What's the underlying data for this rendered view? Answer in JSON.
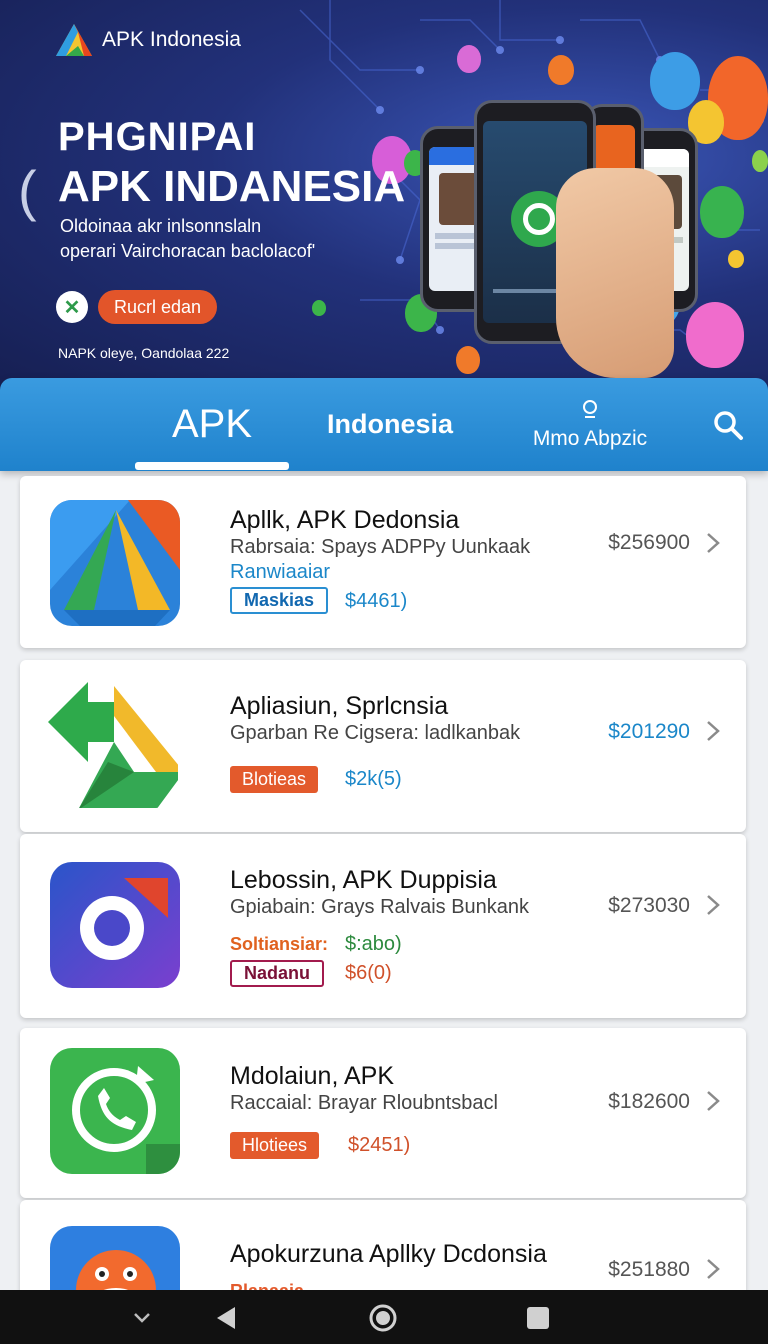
{
  "brand": {
    "name": "APK Indonesia"
  },
  "hero": {
    "title_line1": "PHGNIPAI",
    "title_line2": "APK INDANESIA",
    "subtitle_line1": "Oldoinaa akr inlsonnslaln",
    "subtitle_line2": "operari Vairchoracan baclolacof'",
    "cta_label": "Rucrl edan",
    "footer": "NAPK oleye, Oandolaa 222"
  },
  "tabs": {
    "apk": "APK",
    "indonesia": "Indonesia",
    "more": "Mmo Abpzic"
  },
  "apps": [
    {
      "title": "Apllk, APK Dedonsia",
      "desc": "Rabrsaia: Spays ADPPy Uunkaak",
      "sub": "Ranwiaaiar",
      "tag": "Maskias",
      "tag_price": "$4461)",
      "price": "$256900"
    },
    {
      "title": "Apliasiun, Sprlcnsia",
      "desc": "Gparban Re Cigsera: ladlkanbak",
      "tag": "Blotieas",
      "tag_price": "$2k(5)",
      "price": "$201290"
    },
    {
      "title": "Lebossin, APK Duppisia",
      "desc": "Gpiabain: Grays Ralvais Bunkank",
      "tag1": "Soltiansiar:",
      "tag1_price": "$:abo)",
      "tag2": "Nadanu",
      "tag2_price": "$6(0)",
      "price": "$273030"
    },
    {
      "title": "Mdolaiun, APK",
      "desc": "Raccaial: Brayar Rloubntsbacl",
      "tag": "Hlotiees",
      "tag_price": "$2451)",
      "price": "$182600"
    },
    {
      "title": "Apokurzuna Apllky Dcdonsia",
      "tag": "Rlanaaia",
      "price": "$251880"
    }
  ],
  "colors": {
    "accent": "#1f82cc",
    "price_blue": "#1b87c9",
    "tag_orange": "#e35a2c"
  }
}
